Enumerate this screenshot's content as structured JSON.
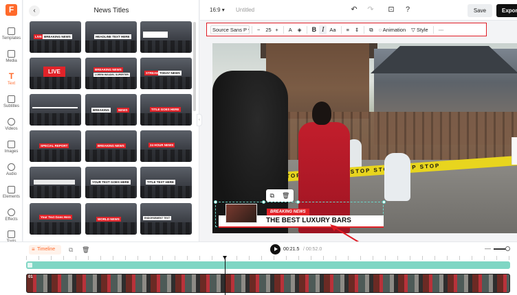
{
  "rail": {
    "items": [
      {
        "label": "Templates",
        "icon": "templates-icon"
      },
      {
        "label": "Media",
        "icon": "media-icon"
      },
      {
        "label": "Text",
        "icon": "text-icon"
      },
      {
        "label": "Subtitles",
        "icon": "subtitles-icon"
      },
      {
        "label": "Videos",
        "icon": "videos-icon"
      },
      {
        "label": "Images",
        "icon": "images-icon"
      },
      {
        "label": "Audio",
        "icon": "audio-icon"
      },
      {
        "label": "Elements",
        "icon": "elements-icon"
      },
      {
        "label": "Effects",
        "icon": "effects-icon"
      },
      {
        "label": "Tools",
        "icon": "tools-icon"
      }
    ],
    "active": "Text",
    "accent_color": "#ff6a2b"
  },
  "panel": {
    "title": "News Titles",
    "thumbs": [
      {
        "tags": [
          "LIVE",
          "BREAKING NEWS"
        ]
      },
      {
        "tags": [
          "HEADLINE TEXT HERE"
        ]
      },
      {
        "tags": []
      },
      {
        "tags": [
          "LIVE"
        ]
      },
      {
        "tags": [
          "BREAKING NEWS",
          "LOREM INSUDEL SUPERTER"
        ]
      },
      {
        "tags": [
          "STREAM",
          "TODAY NEWS"
        ]
      },
      {
        "tags": [
          "BREAKING",
          "NEWS"
        ]
      },
      {
        "tags": [
          "TITLE GOES HERE"
        ]
      },
      {
        "tags": [
          "SPECIAL REPORT"
        ]
      },
      {
        "tags": [
          "BREAKING NEWS"
        ]
      },
      {
        "tags": [
          "24 HOUR NEWS"
        ]
      },
      {
        "tags": [
          "YOUR TEXT GOES HERE"
        ]
      },
      {
        "tags": [
          "TITLE TEXT HERE"
        ]
      },
      {
        "tags": [
          "Your Text Goes Here"
        ]
      },
      {
        "tags": [
          "WORLD NEWS"
        ]
      },
      {
        "tags": [
          "ENDORSEMENT TEXT"
        ]
      }
    ]
  },
  "header": {
    "ratio": "16:9",
    "project_title": "Untitled",
    "save_label": "Save",
    "export_label": "Export"
  },
  "toolbar": {
    "font": "Source Sans P",
    "font_size": "25",
    "minus": "−",
    "plus": "+",
    "case_label": "Aa",
    "animation_label": "Animation",
    "style_label": "Style",
    "highlight_color": "#e01b24"
  },
  "canvas": {
    "lower_third_tag": "BREAKING NEWS",
    "lower_third_headline": "THE BEST LUXURY BARS",
    "tape_text": "STOP  STOP  STOP  STOP  STOP  STOP  STOP"
  },
  "timeline": {
    "tab_label": "Timeline",
    "current_time": "00:21.5",
    "total_time": "/ 00:52.0",
    "track_label": "01"
  }
}
